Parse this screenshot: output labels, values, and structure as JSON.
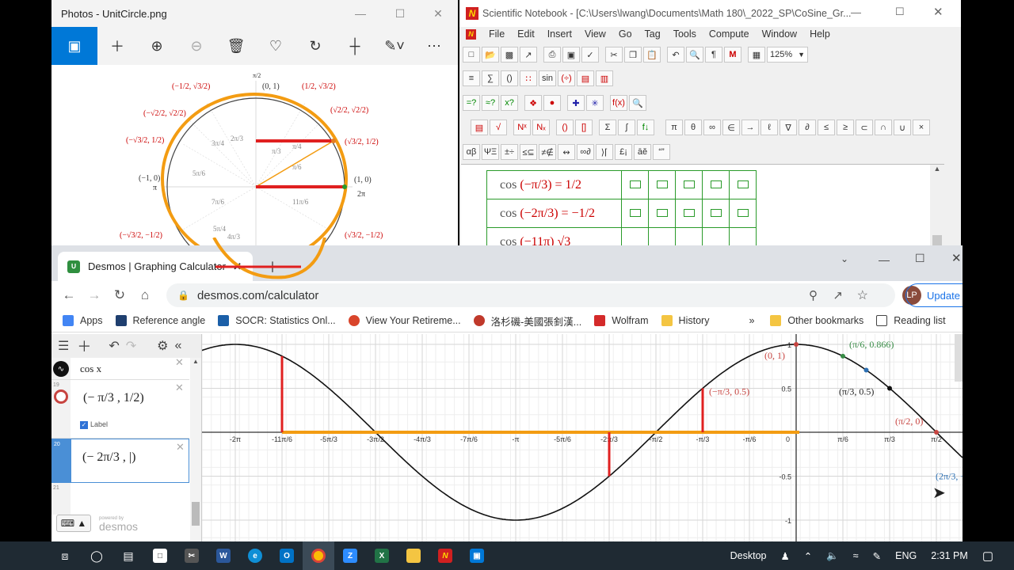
{
  "photos": {
    "title": "Photos - UnitCircle.png",
    "toolbar": [
      "image-icon",
      "add-icon",
      "zoom-in-icon",
      "zoom-out-icon",
      "delete-icon",
      "heart-icon",
      "rotate-icon",
      "crop-icon",
      "edit-icon",
      "more-icon"
    ],
    "circle_labels": {
      "top": "(0, 1)",
      "right": "(1, 0)",
      "left": "(−1, 0)",
      "two_pi": "2π",
      "pi": "π",
      "pi_half": "π/2",
      "q1a": "(1/2, √3/2)",
      "q1b": "(√2/2, √2/2)",
      "q1c": "(√3/2, 1/2)",
      "q2a": "(−1/2, √3/2)",
      "q2b": "(−√2/2, √2/2)",
      "q2c": "(−√3/2, 1/2)",
      "q3c": "(−√3/2, −1/2)",
      "q4c": "(√3/2, −1/2)",
      "angles": [
        "3π/4",
        "2π/3",
        "5π/6",
        "7π/6",
        "5π/4",
        "4π/3",
        "11π/6",
        "π/3",
        "π/4",
        "π/6"
      ]
    }
  },
  "notebook": {
    "title": "Scientific Notebook - [C:\\Users\\lwang\\Documents\\Math 180\\_2022_SP\\CoSine_Gr...",
    "menus": [
      "File",
      "Edit",
      "Insert",
      "View",
      "Go",
      "Tag",
      "Tools",
      "Compute",
      "Window",
      "Help"
    ],
    "zoom": "125%",
    "symbols": [
      "π",
      "θ",
      "∞",
      "∈",
      "→",
      "ℓ",
      "∇",
      "∂",
      "≤",
      "≥",
      "⊂",
      "∩",
      "∪",
      "×"
    ],
    "rows": [
      {
        "lhs": "cos",
        "arg": "−π/3",
        "rhs": "= 1/2"
      },
      {
        "lhs": "cos",
        "arg": "−2π/3",
        "rhs": "= −1/2"
      },
      {
        "lhs": "cos",
        "arg": "−11π",
        "rhs": "√3"
      }
    ]
  },
  "chrome": {
    "tab_title": "Desmos | Graphing Calculator",
    "url": "desmos.com/calculator",
    "profile": "LP",
    "update_label": "Update",
    "bookmarks": [
      {
        "label": "Apps",
        "color": "#4285f4"
      },
      {
        "label": "Reference angle",
        "color": "#1f3f6f"
      },
      {
        "label": "SOCR: Statistics Onl...",
        "color": "#1b5fa8"
      },
      {
        "label": "View Your Retireme...",
        "color": "#d9452b"
      },
      {
        "label": "洛杉磯-美國張釗漢...",
        "color": "#c0392b"
      },
      {
        "label": "Wolfram",
        "color": "#d42a2a"
      },
      {
        "label": "History",
        "color": "#f4c542"
      }
    ],
    "more": "»",
    "other_bookmarks": "Other bookmarks",
    "reading_list": "Reading list"
  },
  "desmos": {
    "expressions": [
      {
        "index": "",
        "text": "cos x"
      },
      {
        "index": "19",
        "text": "(− π/3 , 1/2)",
        "label_checkbox": "Label"
      },
      {
        "index": "20",
        "text": "(− 2π/3 , |)"
      },
      {
        "index": "21",
        "text": ""
      }
    ],
    "powered_by": "powered by",
    "brand": "desmos",
    "x_ticks": [
      "-2π",
      "-11π/6",
      "-5π/3",
      "-3π/2",
      "-4π/3",
      "-7π/6",
      "-π",
      "-5π/6",
      "-2π/3",
      "-π/2",
      "-π/3",
      "-π/6",
      "0",
      "π/6",
      "π/3",
      "π/2"
    ],
    "y_ticks": [
      "1",
      "0.5",
      "-0.5",
      "-1"
    ],
    "point_labels": [
      {
        "text": "(0, 1)",
        "color": "#c74440"
      },
      {
        "text": "(π/6, 0.866)",
        "color": "#388c46"
      },
      {
        "text": "(−π/3, 0.5)",
        "color": "#c74440"
      },
      {
        "text": "(π/3, 0.5)",
        "color": "#222222"
      },
      {
        "text": "(π/2, 0)",
        "color": "#c74440"
      },
      {
        "text": "(2π/3, −0",
        "color": "#2d70b3"
      }
    ]
  },
  "taskbar": {
    "desktop": "Desktop",
    "lang": "ENG",
    "time": "2:31 PM"
  },
  "colors": {
    "accent_blue": "#0078d7",
    "orange": "#f39c12",
    "red": "#e02020",
    "desmos_green": "#2f8f3f"
  }
}
